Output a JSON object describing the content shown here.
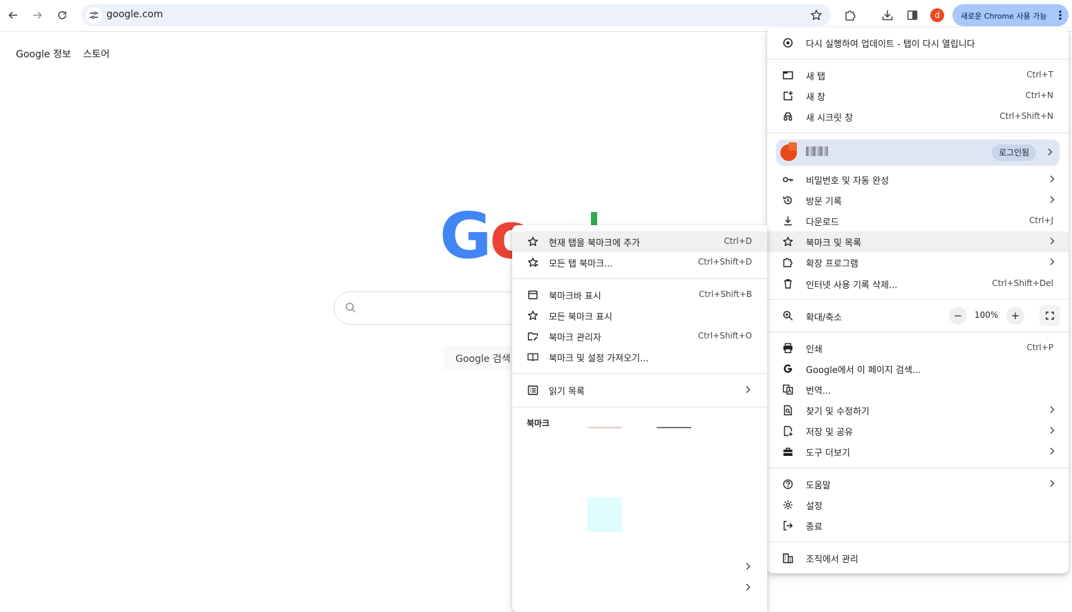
{
  "toolbar": {
    "url": "google.com",
    "avatar_letter": "d",
    "update_chip_label": "새로운 Chrome 사용 가능"
  },
  "page": {
    "top_links": [
      "Google 정보",
      "스토어"
    ],
    "logo_visible": "Go",
    "search_button_label": "Google 검색"
  },
  "main_menu": {
    "update_item": "다시 실행하여 업데이트 - 탭이 다시 열립니다",
    "new_tab": {
      "label": "새 탭",
      "shortcut": "Ctrl+T"
    },
    "new_window": {
      "label": "새 창",
      "shortcut": "Ctrl+N"
    },
    "incognito": {
      "label": "새 시크릿 창",
      "shortcut": "Ctrl+Shift+N"
    },
    "profile": {
      "status": "로그인됨"
    },
    "passwords": {
      "label": "비밀번호 및 자동 완성"
    },
    "history": {
      "label": "방문 기록"
    },
    "downloads": {
      "label": "다운로드",
      "shortcut": "Ctrl+J"
    },
    "bookmarks": {
      "label": "북마크 및 목록"
    },
    "extensions": {
      "label": "확장 프로그램"
    },
    "clear_data": {
      "label": "인터넷 사용 기록 삭제...",
      "shortcut": "Ctrl+Shift+Del"
    },
    "zoom": {
      "label": "확대/축소",
      "minus": "−",
      "value": "100%",
      "plus": "+"
    },
    "print": {
      "label": "인쇄",
      "shortcut": "Ctrl+P"
    },
    "search_page": {
      "label": "Google에서 이 페이지 검색..."
    },
    "translate": {
      "label": "번역..."
    },
    "find_edit": {
      "label": "찾기 및 수정하기"
    },
    "save_share": {
      "label": "저장 및 공유"
    },
    "more_tools": {
      "label": "도구 더보기"
    },
    "help": {
      "label": "도움말"
    },
    "settings": {
      "label": "설정"
    },
    "exit": {
      "label": "종료"
    },
    "managed": {
      "label": "조직에서 관리"
    }
  },
  "bookmarks_menu": {
    "add_current": {
      "label": "현재 탭을 북마크에 추가",
      "shortcut": "Ctrl+D"
    },
    "bookmark_all": {
      "label": "모든 탭 북마크...",
      "shortcut": "Ctrl+Shift+D"
    },
    "show_bar": {
      "label": "북마크바 표시",
      "shortcut": "Ctrl+Shift+B"
    },
    "show_all": {
      "label": "모든 북마크 표시"
    },
    "manager": {
      "label": "북마크 관리자",
      "shortcut": "Ctrl+Shift+O"
    },
    "import": {
      "label": "북마크 및 설정 가져오기..."
    },
    "reading_list": {
      "label": "읽기 목록"
    },
    "heading": "북마크"
  }
}
